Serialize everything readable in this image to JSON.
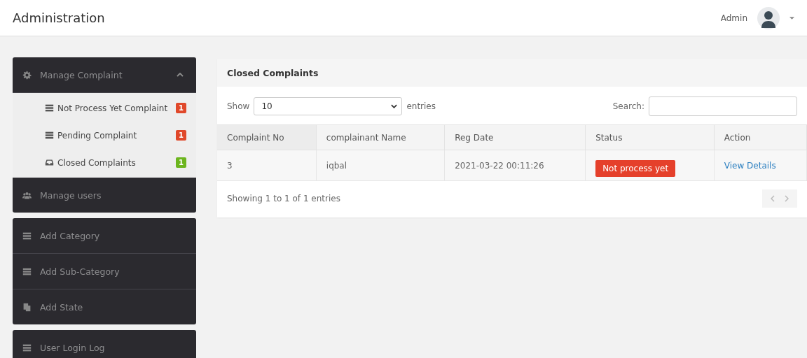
{
  "header": {
    "title": "Administration",
    "user": "Admin"
  },
  "sidebar": {
    "groups": [
      {
        "items": [
          {
            "label": "Manage Complaint",
            "expanded": true,
            "children": [
              {
                "label": "Not Process Yet Complaint",
                "badge": "1",
                "color": "#e0482a"
              },
              {
                "label": "Pending Complaint",
                "badge": "1",
                "color": "#e0482a"
              },
              {
                "label": "Closed Complaints",
                "badge": "1",
                "color": "#6cb51e"
              }
            ]
          },
          {
            "label": "Manage users"
          }
        ]
      },
      {
        "items": [
          {
            "label": "Add Category"
          },
          {
            "label": "Add Sub-Category"
          },
          {
            "label": "Add State"
          }
        ]
      },
      {
        "items": [
          {
            "label": "User Login Log"
          }
        ]
      }
    ]
  },
  "panel": {
    "title": "Closed Complaints",
    "show_label": "Show",
    "page_size": "10",
    "entries_label": "entries",
    "search_label": "Search:",
    "columns": [
      "Complaint No",
      "complainant Name",
      "Reg Date",
      "Status",
      "Action"
    ],
    "rows": [
      {
        "number": "3",
        "name": "iqbal",
        "date": "2021-03-22 00:11:26",
        "status": "Not process yet",
        "action": "View Details"
      }
    ],
    "info": "Showing 1 to 1 of 1 entries",
    "prev_disabled": true,
    "next_disabled": true
  }
}
